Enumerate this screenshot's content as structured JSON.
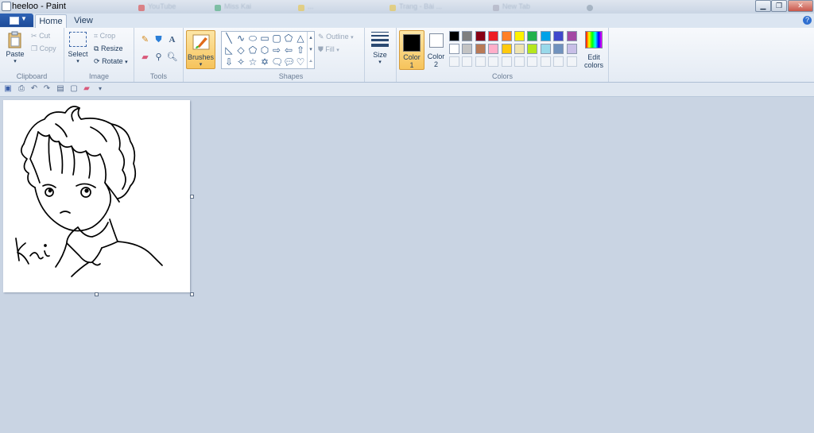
{
  "window": {
    "title": "heeloo - Paint",
    "controls": [
      "minimize",
      "maximize",
      "close"
    ]
  },
  "background_tabs": [
    "YouTube",
    "Miss Kai",
    "...",
    "Trang - Bài ...",
    "New Tab"
  ],
  "tabs": [
    {
      "label": "Home",
      "active": true
    },
    {
      "label": "View",
      "active": false
    }
  ],
  "clipboard": {
    "paste": "Paste",
    "cut": "Cut",
    "copy": "Copy",
    "group": "Clipboard"
  },
  "image": {
    "select": "Select",
    "crop": "Crop",
    "resize": "Resize",
    "rotate": "Rotate",
    "group": "Image"
  },
  "tools": {
    "group": "Tools",
    "text_glyph": "A"
  },
  "brushes": {
    "label": "Brushes"
  },
  "shapes": {
    "outline": "Outline",
    "fill": "Fill",
    "group": "Shapes"
  },
  "size": {
    "label": "Size"
  },
  "colors": {
    "color1_label": "Color",
    "color1_num": "1",
    "color2_label": "Color",
    "color2_num": "2",
    "edit_label": "Edit",
    "edit_label2": "colors",
    "group": "Colors",
    "color1": "#000000",
    "color2": "#ffffff",
    "palette_row1": [
      "#000000",
      "#7f7f7f",
      "#880015",
      "#ed1c24",
      "#ff7f27",
      "#fff200",
      "#22b14c",
      "#00a2e8",
      "#3f48cc",
      "#a349a4"
    ],
    "palette_row2": [
      "#ffffff",
      "#c3c3c3",
      "#b97a57",
      "#ffaec9",
      "#ffc90e",
      "#efe4b0",
      "#b5e61d",
      "#99d9ea",
      "#7092be",
      "#c8bfe7"
    ]
  },
  "drawing": {
    "signature": "Kai"
  }
}
